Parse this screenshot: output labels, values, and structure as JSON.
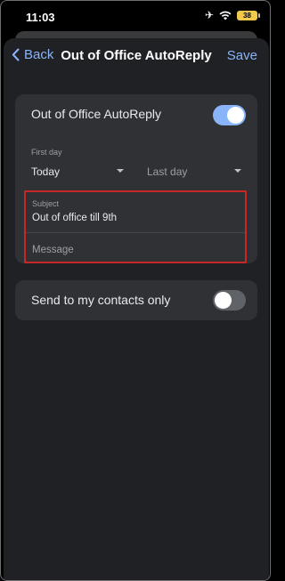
{
  "status": {
    "time": "11:03",
    "battery": "38"
  },
  "nav": {
    "back_label": "Back",
    "title": "Out of Office AutoReply",
    "save_label": "Save"
  },
  "autoreply": {
    "label": "Out of Office AutoReply",
    "enabled": true
  },
  "dates": {
    "first_day_label": "First day",
    "first_day_value": "Today",
    "last_day_placeholder": "Last day"
  },
  "subject": {
    "label": "Subject",
    "value": "Out of office till 9th"
  },
  "message": {
    "placeholder": "Message"
  },
  "contacts_only": {
    "label": "Send to my contacts only",
    "enabled": false
  },
  "colors": {
    "accent": "#8ab4f8",
    "highlight_border": "#c62828",
    "sheet_bg": "#202124",
    "card_bg": "#303134"
  },
  "icons": {
    "back": "chevron-left-icon",
    "airplane": "airplane-icon",
    "wifi": "wifi-icon",
    "battery": "battery-icon"
  }
}
